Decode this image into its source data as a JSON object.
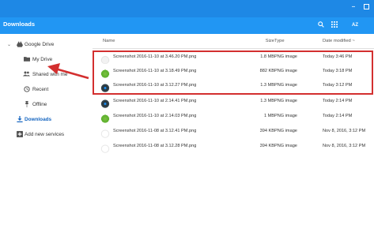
{
  "window": {
    "minimize_glyph": "–",
    "maximize_icon": "maximize-icon"
  },
  "appbar": {
    "title": "Downloads",
    "search_icon": "search-icon",
    "grid_icon": "grid-view-icon",
    "sort_label": "AZ"
  },
  "sidebar": {
    "items": [
      {
        "label": "Google Drive",
        "icon": "google-drive-icon"
      },
      {
        "label": "My Drive",
        "icon": "drive-folder-icon"
      },
      {
        "label": "Shared with me",
        "icon": "people-icon"
      },
      {
        "label": "Recent",
        "icon": "clock-icon"
      },
      {
        "label": "Offline",
        "icon": "pin-icon"
      },
      {
        "label": "Downloads",
        "icon": "download-icon"
      },
      {
        "label": "Add new services",
        "icon": "add-box-icon"
      }
    ]
  },
  "columns": {
    "name": "Name",
    "size": "Size",
    "type": "Type",
    "date": "Date modified ~"
  },
  "files": [
    {
      "name": "Screenshot 2016-11-10 at 3.46.20 PM.png",
      "size": "1.8 MB",
      "type": "PNG image",
      "date": "Today 3:46 PM",
      "thumb": "white"
    },
    {
      "name": "Screenshot 2016-11-10 at 3.18.49 PM.png",
      "size": "882 KB",
      "type": "PNG image",
      "date": "Today 3:18 PM",
      "thumb": "green"
    },
    {
      "name": "Screenshot 2016-11-10 at 3.12.27 PM.png",
      "size": "1.3 MB",
      "type": "PNG image",
      "date": "Today 3:12 PM",
      "thumb": "dark"
    },
    {
      "name": "Screenshot 2016-11-10 at 2.14.41 PM.png",
      "size": "1.3 MB",
      "type": "PNG image",
      "date": "Today 2:14 PM",
      "thumb": "dark"
    },
    {
      "name": "Screenshot 2016-11-10 at 2.14.03 PM.png",
      "size": "1 MB",
      "type": "PNG image",
      "date": "Today 2:14 PM",
      "thumb": "green"
    },
    {
      "name": "Screenshot 2016-11-08 at 3.12.41 PM.png",
      "size": "394 KB",
      "type": "PNG image",
      "date": "Nov 8, 2016, 3:12 PM",
      "thumb": "white2"
    },
    {
      "name": "Screenshot 2016-11-08 at 3.12.28 PM.png",
      "size": "394 KB",
      "type": "PNG image",
      "date": "Nov 8, 2016, 3:12 PM",
      "thumb": "white2"
    }
  ],
  "annotation": {
    "highlight_color": "#d32f2f",
    "arrow_color": "#d32f2f"
  }
}
